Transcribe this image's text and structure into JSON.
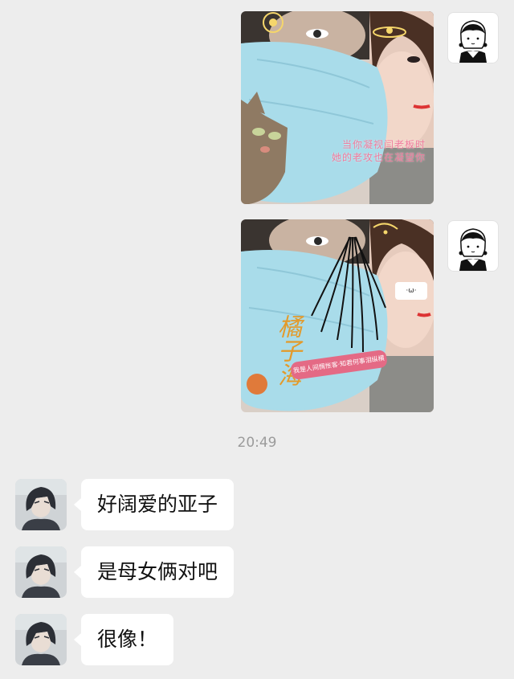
{
  "conversation": {
    "timestamp": "20:49",
    "self_messages": [
      {
        "type": "image",
        "caption_line1": "当你凝视闫老板时",
        "caption_line2": "她的老攻也在凝望你"
      },
      {
        "type": "image",
        "signature_text": "橘子海",
        "sticker_text": "我是人间惆怅客·知君何事泪纵横",
        "face_sticker": "·ω·"
      }
    ],
    "other_messages": [
      {
        "text": "好阔爱的亚子"
      },
      {
        "text": "是母女俩对吧"
      },
      {
        "text": "很像！"
      }
    ]
  },
  "colors": {
    "background": "#ededed",
    "bubble": "#ffffff",
    "timestamp": "#9b9b9b",
    "mask": "#a9dcea",
    "caption": "#f07a9c"
  },
  "icons": {
    "self_avatar": "girl-avatar-icon",
    "other_avatar": "anime-boy-avatar-icon"
  }
}
